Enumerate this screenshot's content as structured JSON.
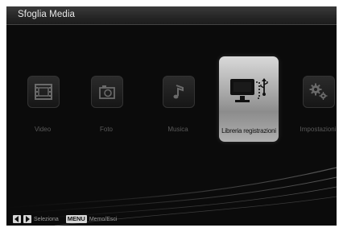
{
  "header": {
    "title": "Sfoglia Media"
  },
  "menu": {
    "items": [
      {
        "label": "Video",
        "icon": "film-strip-icon"
      },
      {
        "label": "Foto",
        "icon": "camera-icon"
      },
      {
        "label": "Musica",
        "icon": "music-note-icon"
      },
      {
        "label": "Libreria registrazioni",
        "icon": "monitor-usb-icon",
        "selected": true
      },
      {
        "label": "Impostazioni",
        "icon": "gears-icon"
      }
    ]
  },
  "footer": {
    "select_hint": "Seleziona",
    "menu_key": "MENU",
    "menu_hint": "Memo/Esci"
  },
  "colors": {
    "background": "#0b0b0b",
    "selected_tile": "#b0b0b0",
    "label_dim": "#5a5a5a"
  }
}
